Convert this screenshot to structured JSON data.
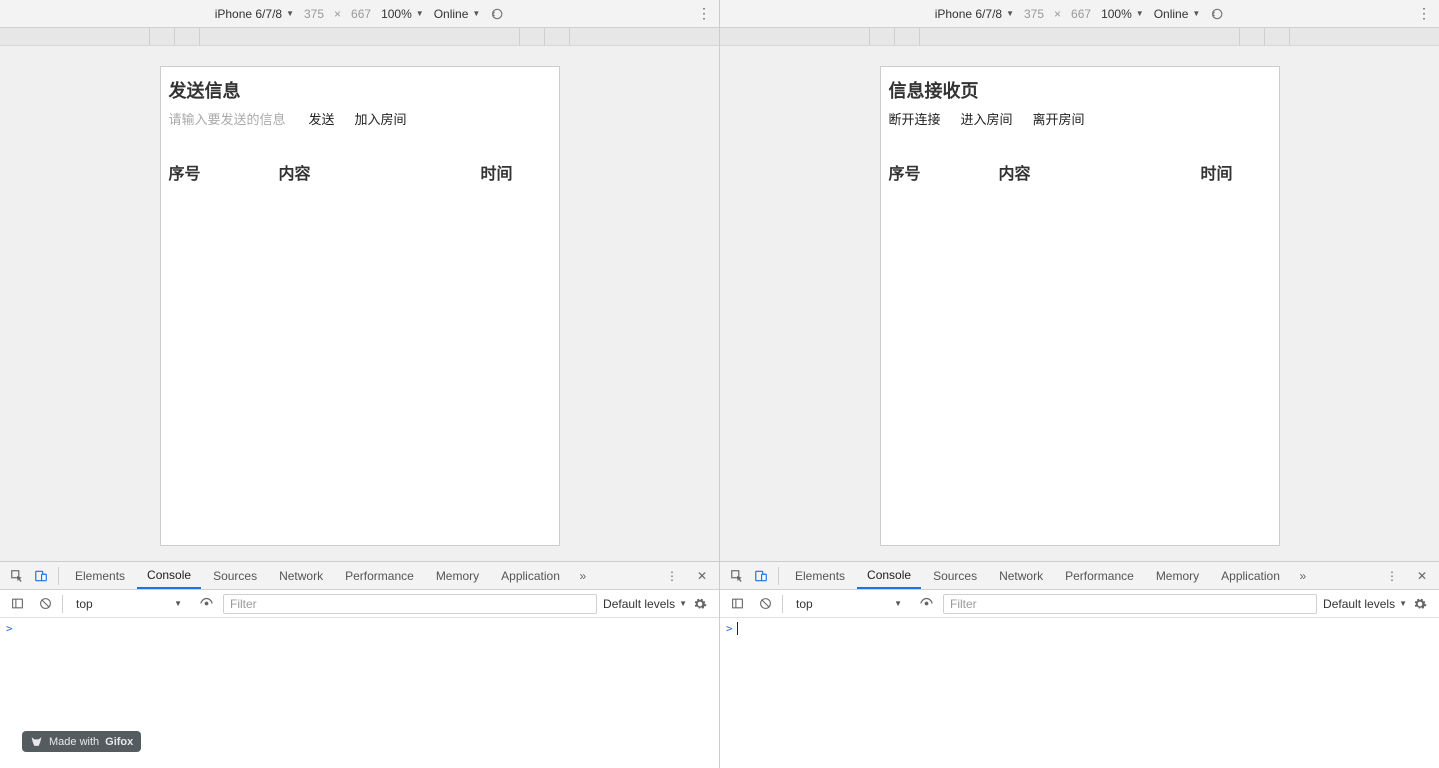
{
  "left": {
    "toolbar": {
      "device": "iPhone 6/7/8",
      "width": "375",
      "x": "×",
      "height": "667",
      "zoom": "100%",
      "online": "Online"
    },
    "app": {
      "title": "发送信息",
      "input_placeholder": "请输入要发送的信息",
      "btn_send": "发送",
      "btn_join": "加入房间",
      "th_index": "序号",
      "th_content": "内容",
      "th_time": "时间"
    },
    "devtools": {
      "tabs": {
        "elements": "Elements",
        "console": "Console",
        "sources": "Sources",
        "network": "Network",
        "performance": "Performance",
        "memory": "Memory",
        "application": "Application"
      },
      "consoleBar": {
        "scope": "top",
        "filter_placeholder": "Filter",
        "levels": "Default levels"
      },
      "prompt": ">"
    }
  },
  "right": {
    "toolbar": {
      "device": "iPhone 6/7/8",
      "width": "375",
      "x": "×",
      "height": "667",
      "zoom": "100%",
      "online": "Online"
    },
    "app": {
      "title": "信息接收页",
      "btn_disconnect": "断开连接",
      "btn_enter": "进入房间",
      "btn_leave": "离开房间",
      "th_index": "序号",
      "th_content": "内容",
      "th_time": "时间"
    },
    "devtools": {
      "tabs": {
        "elements": "Elements",
        "console": "Console",
        "sources": "Sources",
        "network": "Network",
        "performance": "Performance",
        "memory": "Memory",
        "application": "Application"
      },
      "consoleBar": {
        "scope": "top",
        "filter_placeholder": "Filter",
        "levels": "Default levels"
      },
      "prompt": ">"
    }
  },
  "badge": {
    "prefix": "Made with",
    "brand": "Gifox"
  }
}
